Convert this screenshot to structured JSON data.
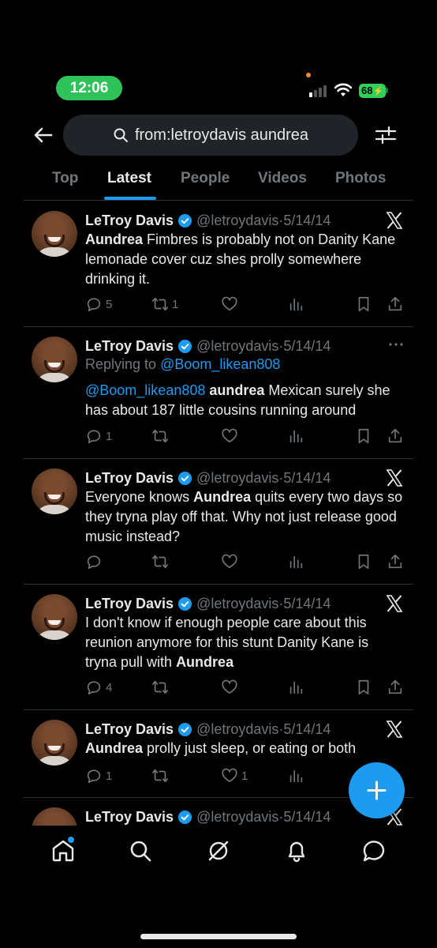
{
  "status_bar": {
    "time": "12:06",
    "battery": "68"
  },
  "search": {
    "query": "from:letroydavis aundrea"
  },
  "tabs": [
    {
      "label": "Top",
      "active": false
    },
    {
      "label": "Latest",
      "active": true
    },
    {
      "label": "People",
      "active": false
    },
    {
      "label": "Videos",
      "active": false
    },
    {
      "label": "Photos",
      "active": false
    }
  ],
  "tweets": [
    {
      "name": "LeTroy Davis",
      "handle": "@letroydavis",
      "date": "5/14/14",
      "text_bold": "Aundrea",
      "text_rest": " Fimbres is probably not on Danity Kane lemonade cover cuz shes prolly somewhere drinking it.",
      "replies": "5",
      "retweets": "1",
      "likes": ""
    },
    {
      "name": "LeTroy Davis",
      "handle": "@letroydavis",
      "date": "5/14/14",
      "replying_prefix": "Replying to ",
      "replying_to": "@Boom_likean808",
      "mention": "@Boom_likean808",
      "text_bold": "aundrea",
      "text_rest": " Mexican surely she has about 187 little cousins running around",
      "replies": "1",
      "retweets": "",
      "likes": ""
    },
    {
      "name": "LeTroy Davis",
      "handle": "@letroydavis",
      "date": "5/14/14",
      "text_pre": "Everyone knows ",
      "text_bold": "Aundrea",
      "text_rest": " quits every two days so they tryna play off that. Why not just release good music instead?",
      "replies": "",
      "retweets": "",
      "likes": ""
    },
    {
      "name": "LeTroy Davis",
      "handle": "@letroydavis",
      "date": "5/14/14",
      "text_pre": "I don't know if enough people care about this reunion anymore for this stunt Danity Kane is tryna pull with ",
      "text_bold": "Aundrea",
      "replies": "4",
      "retweets": "",
      "likes": ""
    },
    {
      "name": "LeTroy Davis",
      "handle": "@letroydavis",
      "date": "5/14/14",
      "text_bold": "Aundrea",
      "text_rest": " prolly just sleep, or eating or both",
      "replies": "1",
      "retweets": "",
      "likes": "1"
    },
    {
      "name": "LeTroy Davis",
      "handle": "@letroydavis",
      "date": "5/14/14"
    }
  ],
  "colors": {
    "accent": "#1d9bf0",
    "background": "#000000",
    "muted": "#71767b",
    "time_pill": "#2fc25a"
  },
  "icons": [
    "back-arrow-icon",
    "search-icon",
    "filter-icon",
    "verified-icon",
    "x-logo-icon",
    "more-icon",
    "reply-icon",
    "retweet-icon",
    "like-icon",
    "views-icon",
    "bookmark-icon",
    "share-icon",
    "compose-icon",
    "home-icon",
    "explore-icon",
    "grok-icon",
    "notifications-icon",
    "messages-icon"
  ]
}
